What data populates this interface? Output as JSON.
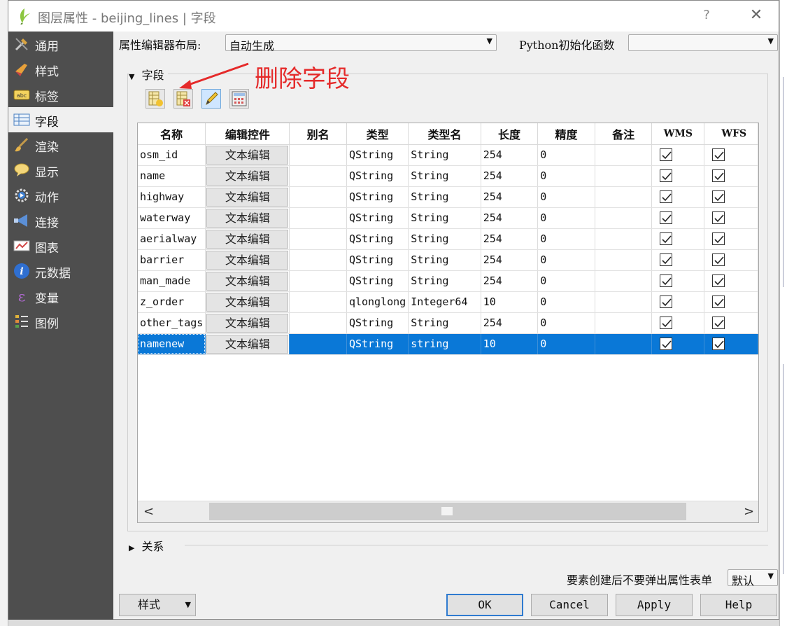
{
  "window": {
    "title": "图层属性 - beijing_lines | 字段",
    "help": "?",
    "close": "✕"
  },
  "sidebar": {
    "items": [
      {
        "label": "通用",
        "icon": "general-tools-icon"
      },
      {
        "label": "样式",
        "icon": "style-brush-icon"
      },
      {
        "label": "标签",
        "icon": "labels-abc-icon"
      },
      {
        "label": "字段",
        "icon": "fields-table-icon"
      },
      {
        "label": "渲染",
        "icon": "rendering-brush-icon"
      },
      {
        "label": "显示",
        "icon": "display-speech-bubble-icon"
      },
      {
        "label": "动作",
        "icon": "actions-gear-icon"
      },
      {
        "label": "连接",
        "icon": "joins-icon"
      },
      {
        "label": "图表",
        "icon": "diagrams-icon"
      },
      {
        "label": "元数据",
        "icon": "metadata-info-icon"
      },
      {
        "label": "变量",
        "icon": "variables-icon"
      },
      {
        "label": "图例",
        "icon": "legend-icon"
      }
    ],
    "active_index": 3
  },
  "editor_layout": {
    "label": "属性编辑器布局:",
    "value": "自动生成"
  },
  "python_init": {
    "label": "Python初始化函数",
    "value": ""
  },
  "fields_section": {
    "title": "字段",
    "annotation": "删除字段",
    "toolbar": [
      {
        "name": "new-field-button",
        "icon": "new-field-icon"
      },
      {
        "name": "delete-field-button",
        "icon": "delete-field-icon"
      },
      {
        "name": "toggle-editing-button",
        "icon": "pencil-edit-icon"
      },
      {
        "name": "field-calculator-button",
        "icon": "calculator-icon"
      }
    ]
  },
  "table": {
    "headers": [
      "名称",
      "编辑控件",
      "别名",
      "类型",
      "类型名",
      "长度",
      "精度",
      "备注",
      "WMS",
      "WFS"
    ],
    "rows": [
      {
        "name": "osm_id",
        "widget": "文本编辑",
        "alias": "",
        "type": "QString",
        "typename": "String",
        "length": "254",
        "precision": "0",
        "comment": "",
        "wms": true,
        "wfs": true
      },
      {
        "name": "name",
        "widget": "文本编辑",
        "alias": "",
        "type": "QString",
        "typename": "String",
        "length": "254",
        "precision": "0",
        "comment": "",
        "wms": true,
        "wfs": true
      },
      {
        "name": "highway",
        "widget": "文本编辑",
        "alias": "",
        "type": "QString",
        "typename": "String",
        "length": "254",
        "precision": "0",
        "comment": "",
        "wms": true,
        "wfs": true
      },
      {
        "name": "waterway",
        "widget": "文本编辑",
        "alias": "",
        "type": "QString",
        "typename": "String",
        "length": "254",
        "precision": "0",
        "comment": "",
        "wms": true,
        "wfs": true
      },
      {
        "name": "aerialway",
        "widget": "文本编辑",
        "alias": "",
        "type": "QString",
        "typename": "String",
        "length": "254",
        "precision": "0",
        "comment": "",
        "wms": true,
        "wfs": true
      },
      {
        "name": "barrier",
        "widget": "文本编辑",
        "alias": "",
        "type": "QString",
        "typename": "String",
        "length": "254",
        "precision": "0",
        "comment": "",
        "wms": true,
        "wfs": true
      },
      {
        "name": "man_made",
        "widget": "文本编辑",
        "alias": "",
        "type": "QString",
        "typename": "String",
        "length": "254",
        "precision": "0",
        "comment": "",
        "wms": true,
        "wfs": true
      },
      {
        "name": "z_order",
        "widget": "文本编辑",
        "alias": "",
        "type": "qlonglong",
        "typename": "Integer64",
        "length": "10",
        "precision": "0",
        "comment": "",
        "wms": true,
        "wfs": true
      },
      {
        "name": "other_tags",
        "widget": "文本编辑",
        "alias": "",
        "type": "QString",
        "typename": "String",
        "length": "254",
        "precision": "0",
        "comment": "",
        "wms": true,
        "wfs": true
      },
      {
        "name": "namenew",
        "widget": "文本编辑",
        "alias": "",
        "type": "QString",
        "typename": "string",
        "length": "10",
        "precision": "0",
        "comment": "",
        "wms": true,
        "wfs": true,
        "selected": true
      }
    ]
  },
  "relations": {
    "title": "关系"
  },
  "suppress_form": {
    "label": "要素创建后不要弹出属性表单",
    "value": "默认"
  },
  "buttons": {
    "style": "样式",
    "ok": "OK",
    "cancel": "Cancel",
    "apply": "Apply",
    "help": "Help"
  },
  "colors": {
    "sidebar_bg": "#4e4e4e",
    "selection": "#0a78d7",
    "annotation": "#e52a2a"
  }
}
